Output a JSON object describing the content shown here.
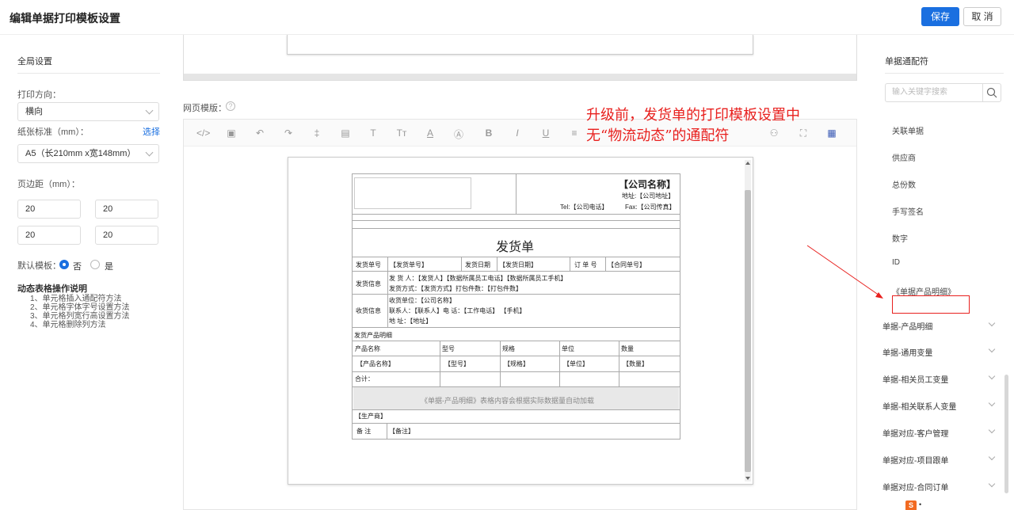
{
  "header": {
    "title": "编辑单据打印模板设置",
    "save_label": "保存",
    "cancel_label": "取 消"
  },
  "left": {
    "section_title": "全局设置",
    "print_direction_label": "打印方向：",
    "print_direction_value": "横向",
    "paper_label": "纸张标准（mm）：",
    "paper_select_link": "选择",
    "paper_value": "A5（长210mm x宽148mm）",
    "margin_label": "页边距（mm）：",
    "margins": [
      "20",
      "20",
      "20",
      "20"
    ],
    "default_template_label": "默认模板：",
    "radio_no": "否",
    "radio_yes": "是",
    "ops_title": "动态表格操作说明",
    "ops": [
      "1、单元格插入通配符方法",
      "2、单元格字体字号设置方法",
      "3、单元格列宽行高设置方法",
      "4、单元格删除列方法"
    ]
  },
  "center": {
    "web_template_label": "网页模版：",
    "help_icon": "?"
  },
  "doc": {
    "company_name": "【公司名称】",
    "address": "地址:【公司地址】",
    "tel": "Tel:【公司电话】",
    "fax": "Fax:【公司传真】",
    "title": "发货单",
    "ship_no_label": "发货单号",
    "ship_no_value": "【发货单号】",
    "ship_date_label": "发货日期",
    "ship_date_value": "【发货日期】",
    "order_no_label": "订 单 号",
    "order_no_value": "【合同单号】",
    "ship_info_label": "发货信息",
    "ship_info_line1": "发 货 人：【发货人】【数据所属员工电话】【数据所属员工手机】",
    "ship_info_line2": "发货方式：【发货方式】打包件数：【打包件数】",
    "recv_info_label": "收货信息",
    "recv_line1": "收货单位：【公司名称】",
    "recv_line2": "联系人：【联系人】电  话：【工作电话】    【手机】",
    "recv_line3": "地  址：【地址】",
    "detail_title": "发货产品明细",
    "columns": [
      "产品名称",
      "型号",
      "规格",
      "单位",
      "数量"
    ],
    "row_values": [
      "【产品名称】",
      "【型号】",
      "【规格】",
      "【单位】",
      "【数量】"
    ],
    "total_label": "合计：",
    "auto_load_note": "《单据-产品明细》表格内容会根据实际数据量自动加载",
    "producer": "【生产商】",
    "remark_label": "备    注",
    "remark_value": "【备注】"
  },
  "annotation": {
    "line1": "升级前，发货单的打印模板设置中",
    "line2": "无“物流动态”的通配符"
  },
  "right": {
    "title": "单据通配符",
    "search_placeholder": "输入关键字搜索",
    "items": [
      "关联单据",
      "供应商",
      "总份数",
      "手写签名",
      "数字",
      "ID",
      "《单据产品明细》"
    ],
    "groups": [
      "单据-产品明细",
      "单据-通用变量",
      "单据-相关员工变量",
      "单据-相关联系人变量",
      "单据对应-客户管理",
      "单据对应-项目跟单",
      "单据对应-合同订单"
    ],
    "logo_badge": "S",
    "logo_dots": "•"
  }
}
